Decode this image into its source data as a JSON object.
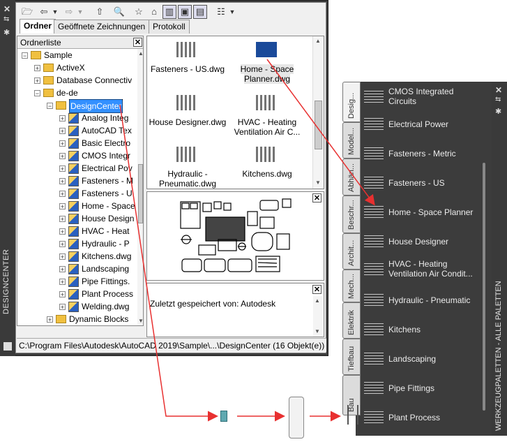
{
  "designcenter": {
    "title": "DESIGNCENTER",
    "tabs": [
      "Ordner",
      "Geöffnete Zeichnungen",
      "Protokoll"
    ],
    "tree_header": "Ordnerliste",
    "tree": [
      {
        "label": "Sample",
        "level": 0
      },
      {
        "label": "ActiveX",
        "level": 1
      },
      {
        "label": "Database Connectivity",
        "level": 1
      },
      {
        "label": "de-de",
        "level": 1
      },
      {
        "label": "DesignCenter",
        "level": 2,
        "selected": true
      },
      {
        "label": "Analog Integrated Circuits.dwg",
        "level": 3
      },
      {
        "label": "AutoCAD Textstyles and Linetypes.dwg",
        "level": 3
      },
      {
        "label": "Basic Electronics.dwg",
        "level": 3
      },
      {
        "label": "CMOS Integrated Circuits.dwg",
        "level": 3
      },
      {
        "label": "Electrical Power.dwg",
        "level": 3
      },
      {
        "label": "Fasteners - Metric.dwg",
        "level": 3
      },
      {
        "label": "Fasteners - US.dwg",
        "level": 3
      },
      {
        "label": "Home - Space Planner.dwg",
        "level": 3
      },
      {
        "label": "House Designer.dwg",
        "level": 3
      },
      {
        "label": "HVAC - Heating Ventilation Air Conditioning.dwg",
        "level": 3
      },
      {
        "label": "Hydraulic - Pneumatic.dwg",
        "level": 3
      },
      {
        "label": "Kitchens.dwg",
        "level": 3
      },
      {
        "label": "Landscaping.dwg",
        "level": 3
      },
      {
        "label": "Pipe Fittings.dwg",
        "level": 3
      },
      {
        "label": "Plant Process.dwg",
        "level": 3
      },
      {
        "label": "Welding.dwg",
        "level": 3
      },
      {
        "label": "Dynamic Blocks",
        "level": 2
      }
    ],
    "tree_visible": [
      "Sample",
      "ActiveX",
      "Database Connectiv",
      "de-de",
      "DesignCenter",
      "Analog Integ",
      "AutoCAD Tex",
      "Basic Electro",
      "CMOS Integr",
      "Electrical Pov",
      "Fasteners - M",
      "Fasteners - U",
      "Home - Space",
      "House Design",
      "HVAC - Heat",
      "Hydraulic - P",
      "Kitchens.dwg",
      "Landscaping",
      "Pipe Fittings.",
      "Plant Process",
      "Welding.dwg",
      "Dynamic Blocks"
    ],
    "thumbnails": [
      {
        "label": "Fasteners - US.dwg"
      },
      {
        "label": "Home - Space Planner.dwg",
        "selected": true
      },
      {
        "label": "House Designer.dwg"
      },
      {
        "label": "HVAC - Heating Ventilation Air C..."
      },
      {
        "label": "Hydraulic - Pneumatic.dwg"
      },
      {
        "label": "Kitchens.dwg"
      }
    ],
    "thumb_lines": {
      "t0": [
        "Fasteners - US.dwg"
      ],
      "t1": [
        "Home - Space",
        "Planner.dwg"
      ],
      "t2": [
        "House Designer.dwg"
      ],
      "t3": [
        "HVAC - Heating",
        "Ventilation Air C..."
      ],
      "t4": [
        "Hydraulic -",
        "Pneumatic.dwg"
      ],
      "t5": [
        "Kitchens.dwg"
      ]
    },
    "description": "Zuletzt gespeichert von: Autodesk",
    "status": "C:\\Program Files\\Autodesk\\AutoCAD 2019\\Sample\\...\\DesignCenter (16 Objekt(e))"
  },
  "toolpalette": {
    "title": "WERKZEUGPALETTEN - ALLE PALETTEN",
    "tabs": [
      "Desig...",
      "Model...",
      "Abhän...",
      "Beschr...",
      "Archit...",
      "Mech...",
      "Elektrik",
      "Tiefbau",
      "Bau"
    ],
    "items": [
      {
        "lines": [
          "CMOS Integrated",
          "Circuits"
        ]
      },
      {
        "lines": [
          "Electrical Power"
        ]
      },
      {
        "lines": [
          "Fasteners - Metric"
        ]
      },
      {
        "lines": [
          "Fasteners - US"
        ]
      },
      {
        "lines": [
          "Home - Space Planner"
        ]
      },
      {
        "lines": [
          "House Designer"
        ]
      },
      {
        "lines": [
          "HVAC - Heating",
          "Ventilation Air Condit..."
        ]
      },
      {
        "lines": [
          "Hydraulic - Pneumatic"
        ]
      },
      {
        "lines": [
          "Kitchens"
        ]
      },
      {
        "lines": [
          "Landscaping"
        ]
      },
      {
        "lines": [
          "Pipe Fittings"
        ]
      },
      {
        "lines": [
          "Plant Process"
        ]
      }
    ]
  },
  "colors": {
    "panel_dark": "#3c3c3c",
    "selection": "#3390ff",
    "arrow": "#e83030"
  }
}
